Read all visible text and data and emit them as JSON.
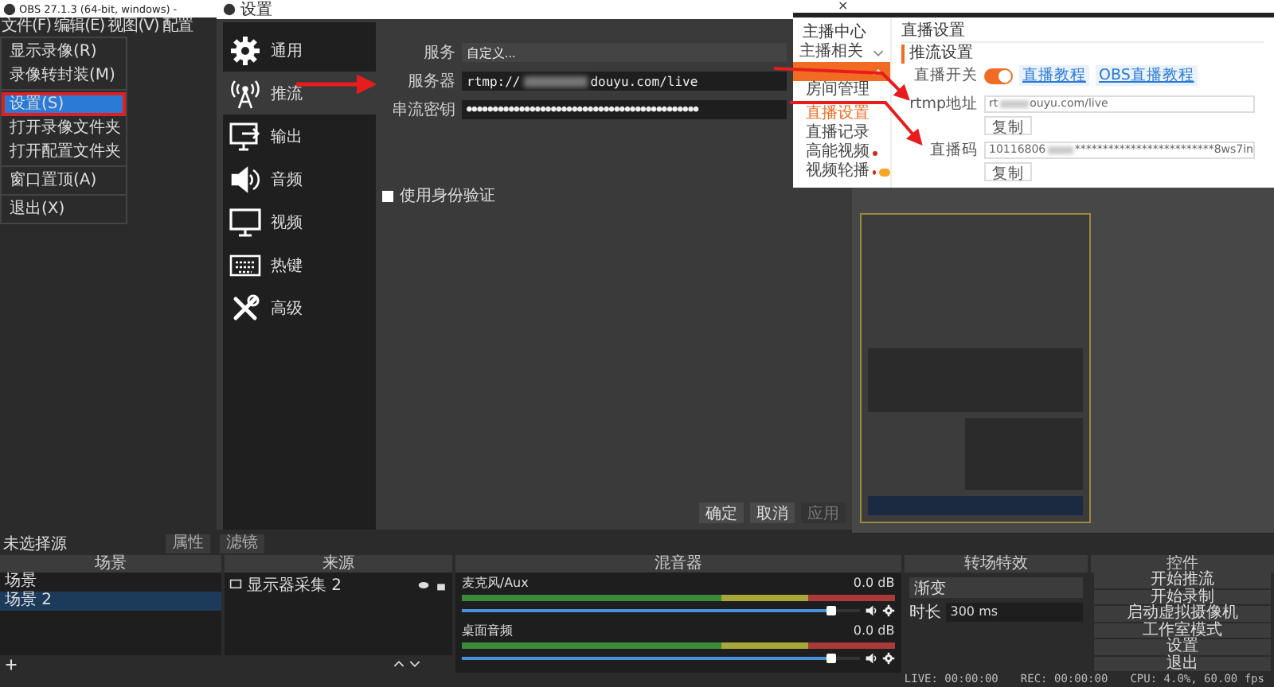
{
  "main_window": {
    "title": "OBS 27.1.3 (64-bit, windows) -",
    "menu": [
      "文件(F)",
      "编辑(E)",
      "视图(V)",
      "配置"
    ]
  },
  "file_menu": {
    "groups": [
      [
        {
          "label": "显示录像(R)",
          "selected": false
        },
        {
          "label": "录像转封装(M)",
          "selected": false
        }
      ],
      [
        {
          "label": "设置(S)",
          "selected": true
        },
        {
          "label": "打开录像文件夹",
          "selected": false
        },
        {
          "label": "打开配置文件夹",
          "selected": false
        }
      ],
      [
        {
          "label": "窗口置顶(A)",
          "selected": false
        }
      ],
      [
        {
          "label": "退出(X)",
          "selected": false
        }
      ]
    ]
  },
  "settings": {
    "title": "设置",
    "sidebar": [
      {
        "label": "通用",
        "kind": "gear",
        "selected": false
      },
      {
        "label": "推流",
        "kind": "antenna",
        "selected": true
      },
      {
        "label": "输出",
        "kind": "output",
        "selected": false
      },
      {
        "label": "音频",
        "kind": "speaker",
        "selected": false
      },
      {
        "label": "视频",
        "kind": "monitor",
        "selected": false
      },
      {
        "label": "热键",
        "kind": "keyboard",
        "selected": false
      },
      {
        "label": "高级",
        "kind": "tools",
        "selected": false
      }
    ],
    "fields": [
      {
        "label": "服务",
        "kind": "select",
        "parts": [
          "自定义..."
        ]
      },
      {
        "label": "服务器",
        "kind": "text",
        "parts": [
          "rtmp://",
          "douyu.com/live"
        ]
      },
      {
        "label": "串流密钥",
        "kind": "secret",
        "parts": [
          "●●●●●●●●●●●●●●●●●●●●●●●●●●●●●●●●●●●●●●●●●●●●"
        ]
      }
    ],
    "auth": {
      "label": "使用身份验证",
      "checked": false
    },
    "buttons": [
      {
        "label": "确定",
        "disabled": false
      },
      {
        "label": "取消",
        "disabled": false
      },
      {
        "label": "应用",
        "disabled": true
      }
    ]
  },
  "douyu": {
    "close": "×",
    "nav_title": "主播中心",
    "nav": [
      {
        "label": "主播相关",
        "kind": "section",
        "selected": false,
        "expanded": false
      },
      {
        "kind": "section",
        "selected": true,
        "expanded": true
      },
      {
        "label": "房间管理",
        "kind": "item",
        "selected": false,
        "dot": false,
        "badge": false
      },
      {
        "label": "直播设置",
        "kind": "item",
        "selected": true,
        "dot": false,
        "badge": false
      },
      {
        "label": "直播记录",
        "kind": "item",
        "selected": false,
        "dot": false,
        "badge": false
      },
      {
        "label": "高能视频",
        "kind": "item",
        "selected": false,
        "dot": true,
        "badge": false
      },
      {
        "label": "视频轮播",
        "kind": "item",
        "selected": false,
        "dot": true,
        "badge": true
      }
    ],
    "title": "直播设置",
    "section": "推流设置",
    "toggle": {
      "label": "直播开关",
      "on": true
    },
    "links": [
      "直播教程",
      "OBS直播教程"
    ],
    "rows": [
      {
        "label": "rtmp地址",
        "parts": [
          "rt",
          "ouyu.com/live"
        ],
        "button": "复制"
      },
      {
        "label": "直播码",
        "parts": [
          "10116806",
          "*************************8ws7in"
        ],
        "button": "复制"
      }
    ]
  },
  "toolbar": {
    "label": "未选择源",
    "buttons": [
      "属性",
      "滤镜"
    ]
  },
  "scenes": {
    "title": "场景",
    "items": [
      {
        "label": "场景",
        "selected": false
      },
      {
        "label": "场景 2",
        "selected": true
      }
    ]
  },
  "sources": {
    "title": "来源",
    "items": [
      {
        "label": "显示器采集 2"
      }
    ]
  },
  "mixer": {
    "title": "混音器",
    "channels": [
      {
        "name": "麦克风/Aux",
        "reading": "0.0 dB",
        "level": 0.93
      },
      {
        "name": "桌面音频",
        "reading": "0.0 dB",
        "level": 0.93
      }
    ]
  },
  "transitions": {
    "title": "转场特效",
    "transition": "渐变",
    "duration_label": "时长",
    "duration": "300 ms"
  },
  "controls": {
    "title": "控件",
    "buttons": [
      "开始推流",
      "开始录制",
      "启动虚拟摄像机",
      "工作室模式",
      "设置",
      "退出"
    ]
  },
  "status_bar": [
    "LIVE: 00:00:00",
    "REC: 00:00:00",
    "CPU: 4.0%, 60.00 fps"
  ]
}
